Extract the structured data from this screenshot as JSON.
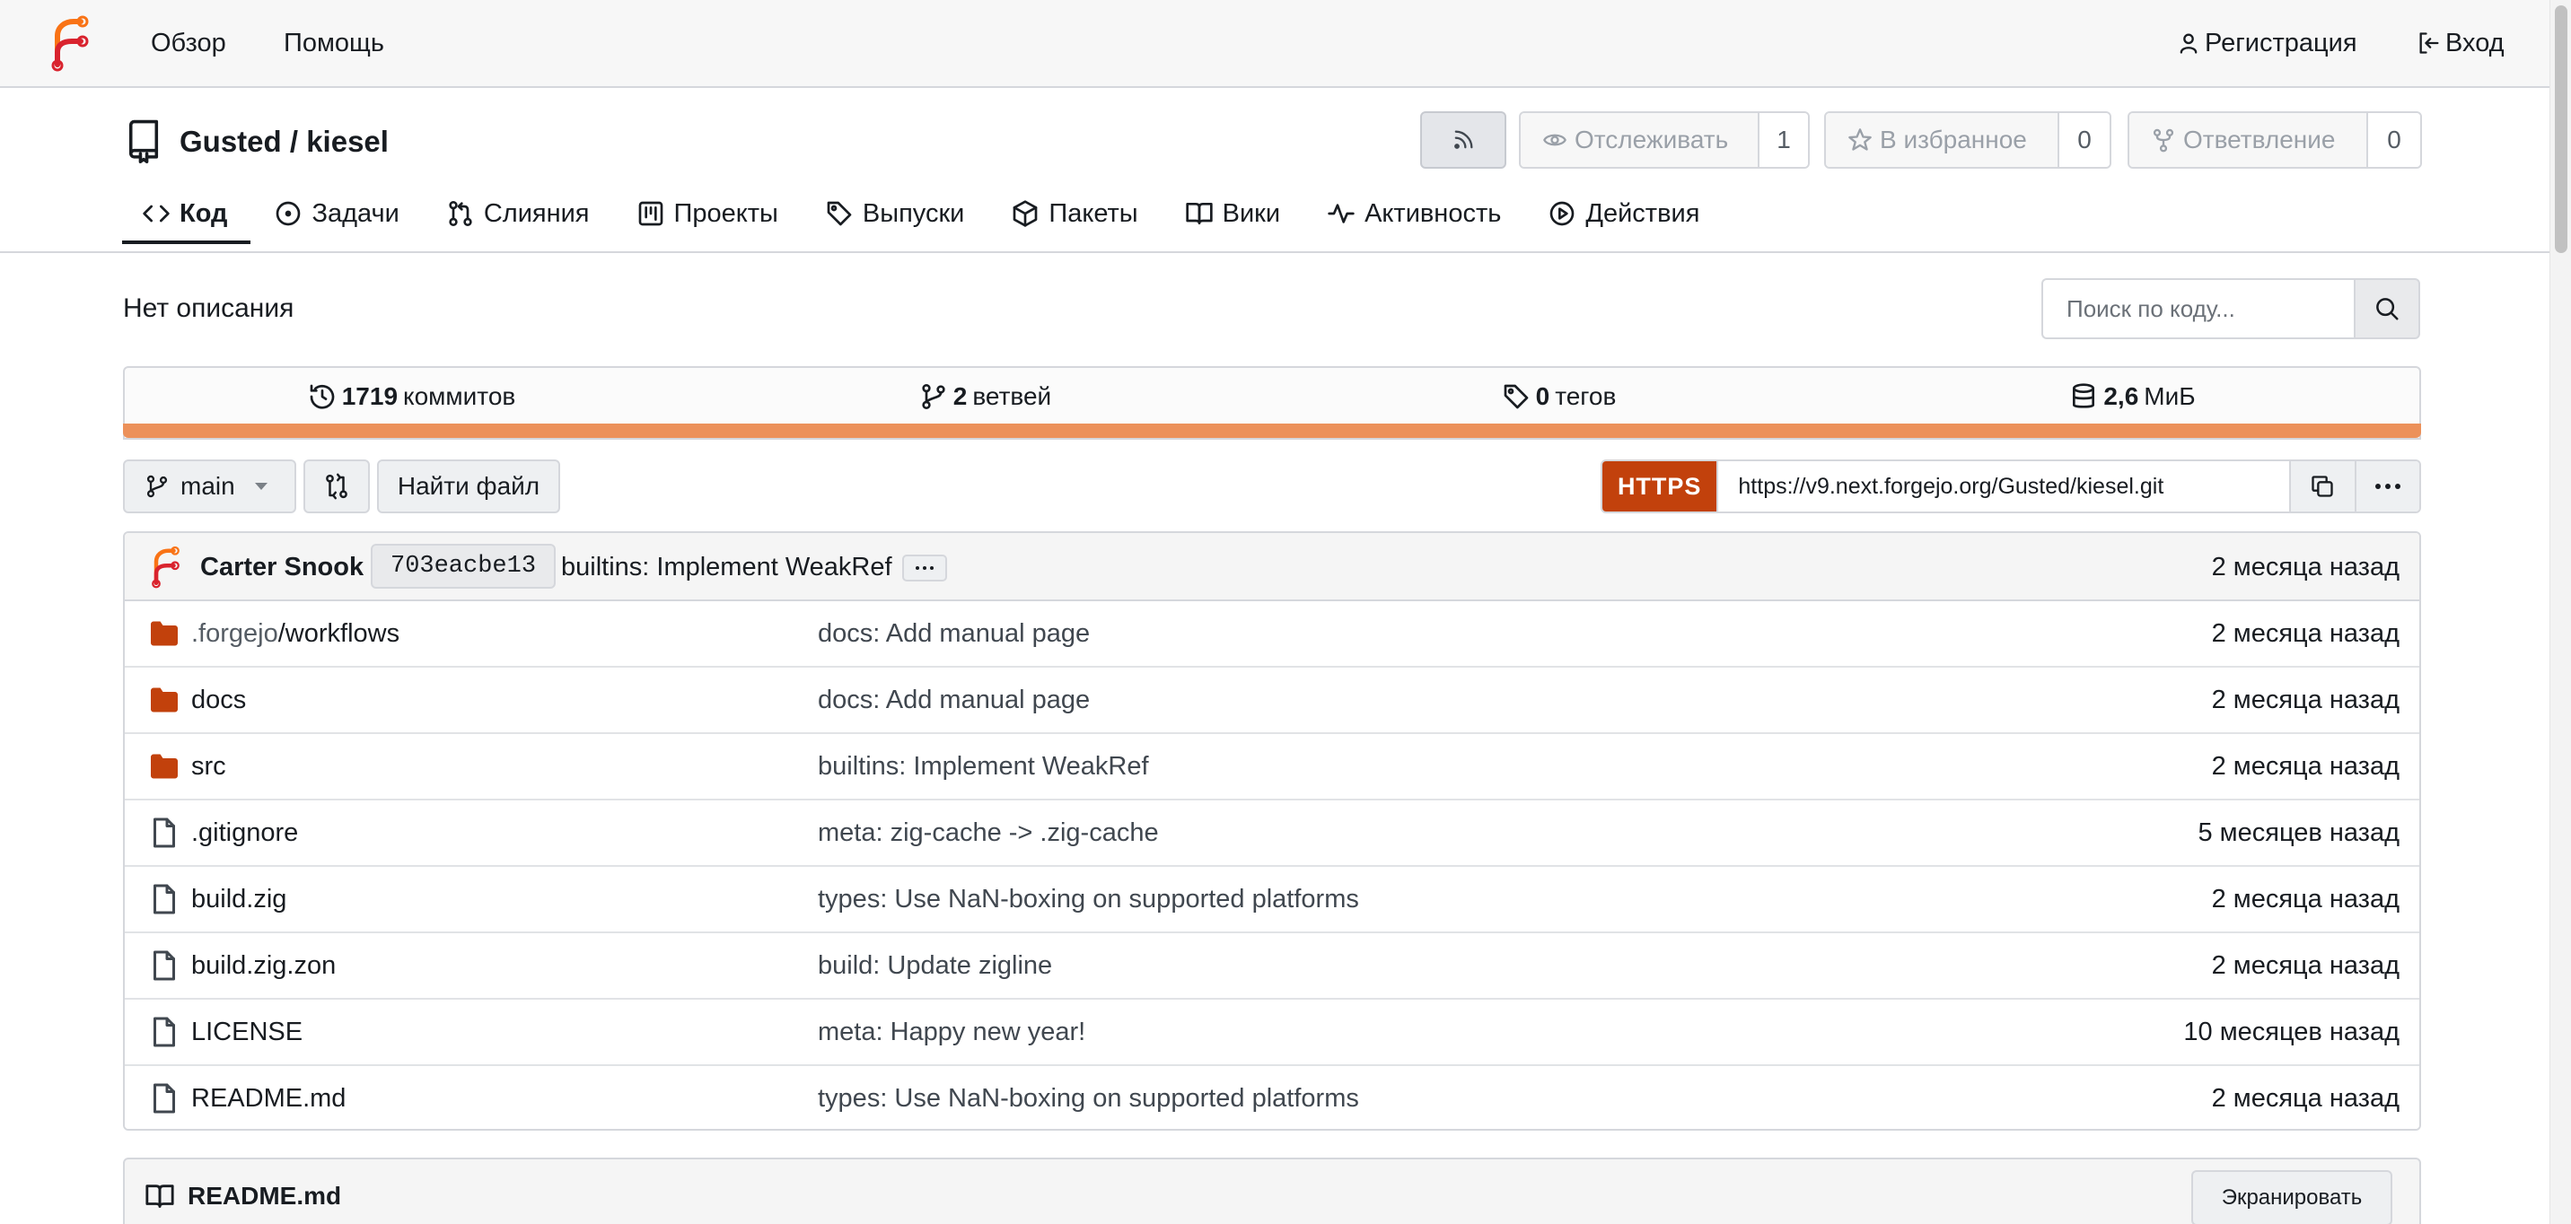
{
  "nav": {
    "explore": "Обзор",
    "help": "Помощь",
    "register": "Регистрация",
    "login": "Вход"
  },
  "repo": {
    "owner": "Gusted",
    "separator": " / ",
    "name": "kiesel",
    "watch_label": "Отслеживать",
    "watch_count": "1",
    "star_label": "В избранное",
    "star_count": "0",
    "fork_label": "Ответвление",
    "fork_count": "0"
  },
  "tabs": [
    {
      "label": "Код",
      "icon": "code-icon",
      "active": true
    },
    {
      "label": "Задачи",
      "icon": "issue-icon"
    },
    {
      "label": "Слияния",
      "icon": "pull-request-icon"
    },
    {
      "label": "Проекты",
      "icon": "project-icon"
    },
    {
      "label": "Выпуски",
      "icon": "tag-icon"
    },
    {
      "label": "Пакеты",
      "icon": "package-icon"
    },
    {
      "label": "Вики",
      "icon": "book-icon"
    },
    {
      "label": "Активность",
      "icon": "pulse-icon"
    },
    {
      "label": "Действия",
      "icon": "play-icon"
    }
  ],
  "description": "Нет описания",
  "search": {
    "placeholder": "Поиск по коду..."
  },
  "stats": {
    "commits_count": "1719",
    "commits_label": "коммитов",
    "branches_count": "2",
    "branches_label": "ветвей",
    "tags_count": "0",
    "tags_label": "тегов",
    "size_count": "2,6",
    "size_label": "МиБ"
  },
  "colors": {
    "accent": "#c2410c",
    "language_bar": "#ec915a",
    "folder": "#c2410c"
  },
  "branch": {
    "name": "main",
    "find_file": "Найти файл"
  },
  "clone": {
    "protocol": "HTTPS",
    "url": "https://v9.next.forgejo.org/Gusted/kiesel.git"
  },
  "latest_commit": {
    "author": "Carter Snook",
    "sha": "703eacbe13",
    "message": "builtins: Implement WeakRef",
    "time": "2 месяца назад"
  },
  "files": [
    {
      "type": "folder",
      "name_prefix": ".forgejo",
      "name": "/workflows",
      "message": "docs: Add manual page",
      "time": "2 месяца назад"
    },
    {
      "type": "folder",
      "name_prefix": "",
      "name": "docs",
      "message": "docs: Add manual page",
      "time": "2 месяца назад"
    },
    {
      "type": "folder",
      "name_prefix": "",
      "name": "src",
      "message": "builtins: Implement WeakRef",
      "time": "2 месяца назад"
    },
    {
      "type": "file",
      "name_prefix": "",
      "name": ".gitignore",
      "message": "meta: zig-cache -> .zig-cache",
      "time": "5 месяцев назад"
    },
    {
      "type": "file",
      "name_prefix": "",
      "name": "build.zig",
      "message": "types: Use NaN-boxing on supported platforms",
      "time": "2 месяца назад"
    },
    {
      "type": "file",
      "name_prefix": "",
      "name": "build.zig.zon",
      "message": "build: Update zigline",
      "time": "2 месяца назад"
    },
    {
      "type": "file",
      "name_prefix": "",
      "name": "LICENSE",
      "message": "meta: Happy new year!",
      "time": "10 месяцев назад"
    },
    {
      "type": "file",
      "name_prefix": "",
      "name": "README.md",
      "message": "types: Use NaN-boxing on supported platforms",
      "time": "2 месяца назад"
    }
  ],
  "readme": {
    "title": "README.md",
    "escape_button": "Экранировать"
  }
}
